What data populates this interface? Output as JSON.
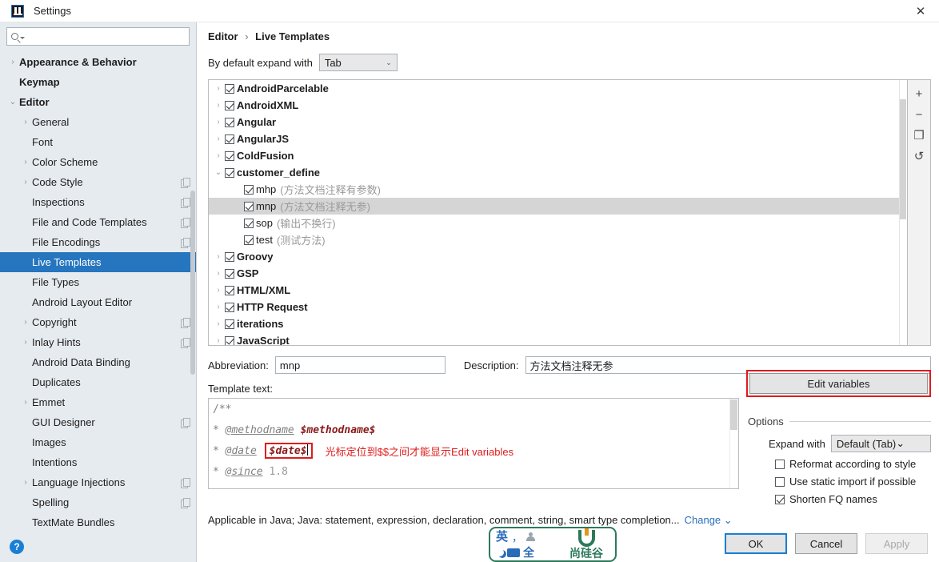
{
  "window": {
    "title": "Settings",
    "close_label": "✕",
    "app_icon": "intellij-idea-icon"
  },
  "sidebar": {
    "search_placeholder": "",
    "search_icon": "search-icon",
    "items": [
      {
        "label": "Appearance & Behavior",
        "level": 0,
        "arrow": "›",
        "bold": true,
        "selected": false,
        "copy": false
      },
      {
        "label": "Keymap",
        "level": 0,
        "arrow": "",
        "bold": true,
        "selected": false,
        "copy": false
      },
      {
        "label": "Editor",
        "level": 0,
        "arrow": "⌄",
        "bold": true,
        "selected": false,
        "copy": false
      },
      {
        "label": "General",
        "level": 1,
        "arrow": "›",
        "bold": false,
        "selected": false,
        "copy": false
      },
      {
        "label": "Font",
        "level": 1,
        "arrow": "",
        "bold": false,
        "selected": false,
        "copy": false
      },
      {
        "label": "Color Scheme",
        "level": 1,
        "arrow": "›",
        "bold": false,
        "selected": false,
        "copy": false
      },
      {
        "label": "Code Style",
        "level": 1,
        "arrow": "›",
        "bold": false,
        "selected": false,
        "copy": true
      },
      {
        "label": "Inspections",
        "level": 1,
        "arrow": "",
        "bold": false,
        "selected": false,
        "copy": true
      },
      {
        "label": "File and Code Templates",
        "level": 1,
        "arrow": "",
        "bold": false,
        "selected": false,
        "copy": true
      },
      {
        "label": "File Encodings",
        "level": 1,
        "arrow": "",
        "bold": false,
        "selected": false,
        "copy": true
      },
      {
        "label": "Live Templates",
        "level": 1,
        "arrow": "",
        "bold": false,
        "selected": true,
        "copy": false
      },
      {
        "label": "File Types",
        "level": 1,
        "arrow": "",
        "bold": false,
        "selected": false,
        "copy": false
      },
      {
        "label": "Android Layout Editor",
        "level": 1,
        "arrow": "",
        "bold": false,
        "selected": false,
        "copy": false
      },
      {
        "label": "Copyright",
        "level": 1,
        "arrow": "›",
        "bold": false,
        "selected": false,
        "copy": true
      },
      {
        "label": "Inlay Hints",
        "level": 1,
        "arrow": "›",
        "bold": false,
        "selected": false,
        "copy": true
      },
      {
        "label": "Android Data Binding",
        "level": 1,
        "arrow": "",
        "bold": false,
        "selected": false,
        "copy": false
      },
      {
        "label": "Duplicates",
        "level": 1,
        "arrow": "",
        "bold": false,
        "selected": false,
        "copy": false
      },
      {
        "label": "Emmet",
        "level": 1,
        "arrow": "›",
        "bold": false,
        "selected": false,
        "copy": false
      },
      {
        "label": "GUI Designer",
        "level": 1,
        "arrow": "",
        "bold": false,
        "selected": false,
        "copy": true
      },
      {
        "label": "Images",
        "level": 1,
        "arrow": "",
        "bold": false,
        "selected": false,
        "copy": false
      },
      {
        "label": "Intentions",
        "level": 1,
        "arrow": "",
        "bold": false,
        "selected": false,
        "copy": false
      },
      {
        "label": "Language Injections",
        "level": 1,
        "arrow": "›",
        "bold": false,
        "selected": false,
        "copy": true
      },
      {
        "label": "Spelling",
        "level": 1,
        "arrow": "",
        "bold": false,
        "selected": false,
        "copy": true
      },
      {
        "label": "TextMate Bundles",
        "level": 1,
        "arrow": "",
        "bold": false,
        "selected": false,
        "copy": false
      }
    ],
    "help_label": "?"
  },
  "main": {
    "breadcrumb": {
      "parent": "Editor",
      "separator": "›",
      "current": "Live Templates"
    },
    "expand": {
      "label": "By default expand with",
      "value": "Tab",
      "chevron": "⌄"
    },
    "tree": [
      {
        "name": "AndroidParcelable",
        "desc": "",
        "arrow": "›",
        "checked": true,
        "child": false,
        "selected": false
      },
      {
        "name": "AndroidXML",
        "desc": "",
        "arrow": "›",
        "checked": true,
        "child": false,
        "selected": false
      },
      {
        "name": "Angular",
        "desc": "",
        "arrow": "›",
        "checked": true,
        "child": false,
        "selected": false
      },
      {
        "name": "AngularJS",
        "desc": "",
        "arrow": "›",
        "checked": true,
        "child": false,
        "selected": false
      },
      {
        "name": "ColdFusion",
        "desc": "",
        "arrow": "›",
        "checked": true,
        "child": false,
        "selected": false
      },
      {
        "name": "customer_define",
        "desc": "",
        "arrow": "⌄",
        "checked": true,
        "child": false,
        "selected": false
      },
      {
        "name": "mhp",
        "desc": "(方法文档注释有参数)",
        "arrow": "",
        "checked": true,
        "child": true,
        "selected": false
      },
      {
        "name": "mnp",
        "desc": "(方法文档注释无参)",
        "arrow": "",
        "checked": true,
        "child": true,
        "selected": true
      },
      {
        "name": "sop",
        "desc": "(输出不换行)",
        "arrow": "",
        "checked": true,
        "child": true,
        "selected": false
      },
      {
        "name": "test",
        "desc": "(测试方法)",
        "arrow": "",
        "checked": true,
        "child": true,
        "selected": false
      },
      {
        "name": "Groovy",
        "desc": "",
        "arrow": "›",
        "checked": true,
        "child": false,
        "selected": false
      },
      {
        "name": "GSP",
        "desc": "",
        "arrow": "›",
        "checked": true,
        "child": false,
        "selected": false
      },
      {
        "name": "HTML/XML",
        "desc": "",
        "arrow": "›",
        "checked": true,
        "child": false,
        "selected": false
      },
      {
        "name": "HTTP Request",
        "desc": "",
        "arrow": "›",
        "checked": true,
        "child": false,
        "selected": false
      },
      {
        "name": "iterations",
        "desc": "",
        "arrow": "›",
        "checked": true,
        "child": false,
        "selected": false
      },
      {
        "name": "JavaScript",
        "desc": "",
        "arrow": "›",
        "checked": true,
        "child": false,
        "selected": false
      }
    ],
    "tree_toolbar": [
      {
        "icon": "plus-icon",
        "glyph": "+"
      },
      {
        "icon": "minus-icon",
        "glyph": "−"
      },
      {
        "icon": "duplicate-icon",
        "glyph": "❐"
      },
      {
        "icon": "revert-icon",
        "glyph": "↺"
      }
    ],
    "abbreviation": {
      "label": "Abbreviation:",
      "value": "mnp"
    },
    "description": {
      "label": "Description:",
      "value": "方法文档注释无参"
    },
    "template_text_label": "Template text:",
    "editor_lines": {
      "l1": "/**",
      "l2_star": "*",
      "l2_tag": "@methodname",
      "l2_var": "$methodname$",
      "l3_star": "*",
      "l3_tag": "@date",
      "l3_var": "$date$",
      "l3_note": "光标定位到$$之间才能显示Edit variables",
      "l4_star": "*",
      "l4_tag": "@since",
      "l4_val": "1.8"
    },
    "edit_variables_button": "Edit variables",
    "options": {
      "title": "Options",
      "expand_with_label": "Expand with",
      "expand_with_value": "Default (Tab)",
      "chevron": "⌄",
      "checkboxes": [
        {
          "label": "Reformat according to style",
          "checked": false
        },
        {
          "label": "Use static import if possible",
          "checked": false
        },
        {
          "label": "Shorten FQ names",
          "checked": true
        }
      ]
    },
    "applicable": {
      "text": "Applicable in Java; Java: statement, expression, declaration, comment, string, smart type completion...",
      "change_label": "Change",
      "change_chevron": "⌄"
    },
    "buttons": {
      "ok": "OK",
      "cancel": "Cancel",
      "apply": "Apply"
    }
  },
  "ime": {
    "mode": "英",
    "punctuation": "，",
    "person_icon": "user-icon",
    "moon_icon": "moon-icon",
    "keyboard_icon": "keyboard-icon",
    "width_mode": "全",
    "logo_icon": "u-logo-icon",
    "brand": "尚硅谷"
  },
  "colors": {
    "accent": "#2675bf",
    "sidebar_bg": "#e6ebef",
    "annotation_red": "#e01b1b",
    "link_blue": "#2a6ebb",
    "ime_green": "#2c7a5a"
  }
}
